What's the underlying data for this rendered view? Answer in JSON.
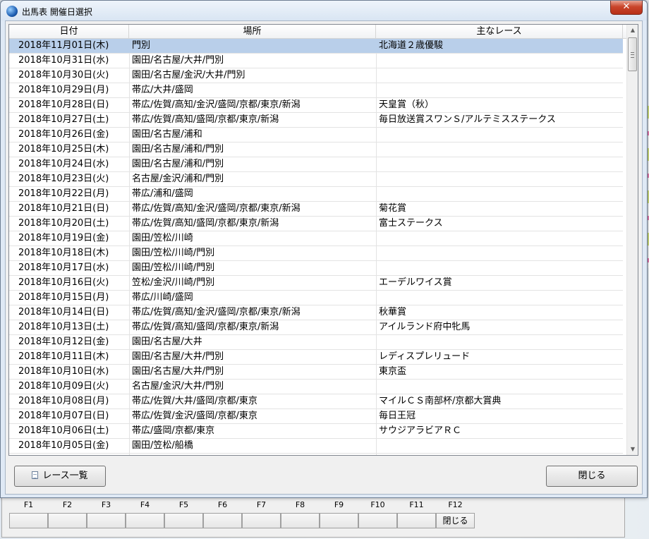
{
  "window": {
    "title": "出馬表 開催日選択",
    "close_label": "✕"
  },
  "table": {
    "headers": [
      "日付",
      "場所",
      "主なレース"
    ],
    "selected_index": 0,
    "rows": [
      {
        "date": "2018年11月01日(木)",
        "venue": "門別",
        "race": "北海道２歳優駿"
      },
      {
        "date": "2018年10月31日(水)",
        "venue": "園田/名古屋/大井/門別",
        "race": ""
      },
      {
        "date": "2018年10月30日(火)",
        "venue": "園田/名古屋/金沢/大井/門別",
        "race": ""
      },
      {
        "date": "2018年10月29日(月)",
        "venue": "帯広/大井/盛岡",
        "race": ""
      },
      {
        "date": "2018年10月28日(日)",
        "venue": "帯広/佐賀/高知/金沢/盛岡/京都/東京/新潟",
        "race": "天皇賞（秋）"
      },
      {
        "date": "2018年10月27日(土)",
        "venue": "帯広/佐賀/高知/盛岡/京都/東京/新潟",
        "race": "毎日放送賞スワンＳ/アルテミスステークス"
      },
      {
        "date": "2018年10月26日(金)",
        "venue": "園田/名古屋/浦和",
        "race": ""
      },
      {
        "date": "2018年10月25日(木)",
        "venue": "園田/名古屋/浦和/門別",
        "race": ""
      },
      {
        "date": "2018年10月24日(水)",
        "venue": "園田/名古屋/浦和/門別",
        "race": ""
      },
      {
        "date": "2018年10月23日(火)",
        "venue": "名古屋/金沢/浦和/門別",
        "race": ""
      },
      {
        "date": "2018年10月22日(月)",
        "venue": "帯広/浦和/盛岡",
        "race": ""
      },
      {
        "date": "2018年10月21日(日)",
        "venue": "帯広/佐賀/高知/金沢/盛岡/京都/東京/新潟",
        "race": "菊花賞"
      },
      {
        "date": "2018年10月20日(土)",
        "venue": "帯広/佐賀/高知/盛岡/京都/東京/新潟",
        "race": "富士ステークス"
      },
      {
        "date": "2018年10月19日(金)",
        "venue": "園田/笠松/川崎",
        "race": ""
      },
      {
        "date": "2018年10月18日(木)",
        "venue": "園田/笠松/川崎/門別",
        "race": ""
      },
      {
        "date": "2018年10月17日(水)",
        "venue": "園田/笠松/川崎/門別",
        "race": ""
      },
      {
        "date": "2018年10月16日(火)",
        "venue": "笠松/金沢/川崎/門別",
        "race": "エーデルワイス賞"
      },
      {
        "date": "2018年10月15日(月)",
        "venue": "帯広/川崎/盛岡",
        "race": ""
      },
      {
        "date": "2018年10月14日(日)",
        "venue": "帯広/佐賀/高知/金沢/盛岡/京都/東京/新潟",
        "race": "秋華賞"
      },
      {
        "date": "2018年10月13日(土)",
        "venue": "帯広/佐賀/高知/盛岡/京都/東京/新潟",
        "race": "アイルランド府中牝馬"
      },
      {
        "date": "2018年10月12日(金)",
        "venue": "園田/名古屋/大井",
        "race": ""
      },
      {
        "date": "2018年10月11日(木)",
        "venue": "園田/名古屋/大井/門別",
        "race": "レディスプレリュード"
      },
      {
        "date": "2018年10月10日(水)",
        "venue": "園田/名古屋/大井/門別",
        "race": "東京盃"
      },
      {
        "date": "2018年10月09日(火)",
        "venue": "名古屋/金沢/大井/門別",
        "race": ""
      },
      {
        "date": "2018年10月08日(月)",
        "venue": "帯広/佐賀/大井/盛岡/京都/東京",
        "race": "マイルＣＳ南部杯/京都大賞典"
      },
      {
        "date": "2018年10月07日(日)",
        "venue": "帯広/佐賀/金沢/盛岡/京都/東京",
        "race": "毎日王冠"
      },
      {
        "date": "2018年10月06日(土)",
        "venue": "帯広/盛岡/京都/東京",
        "race": "サウジアラビアＲＣ"
      },
      {
        "date": "2018年10月05日(金)",
        "venue": "園田/笠松/船橋",
        "race": ""
      }
    ]
  },
  "buttons": {
    "race_list": "レース一覧",
    "close": "閉じる"
  },
  "fkeys": [
    {
      "key": "F1",
      "label": ""
    },
    {
      "key": "F2",
      "label": ""
    },
    {
      "key": "F3",
      "label": ""
    },
    {
      "key": "F4",
      "label": ""
    },
    {
      "key": "F5",
      "label": ""
    },
    {
      "key": "F6",
      "label": ""
    },
    {
      "key": "F7",
      "label": ""
    },
    {
      "key": "F8",
      "label": ""
    },
    {
      "key": "F9",
      "label": ""
    },
    {
      "key": "F10",
      "label": ""
    },
    {
      "key": "F11",
      "label": ""
    },
    {
      "key": "F12",
      "label": "閉じる"
    }
  ]
}
